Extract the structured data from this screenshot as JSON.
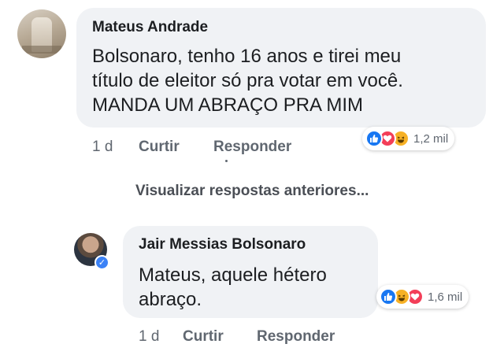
{
  "comment": {
    "author": "Mateus Andrade",
    "lines": [
      "Bolsonaro, tenho 16 anos e tirei meu",
      "título de eleitor só pra votar em você.",
      "MANDA UM ABRAÇO PRA MIM"
    ],
    "time": "1 d",
    "like_label": "Curtir",
    "reply_label": "Responder",
    "reactions": {
      "icons": [
        "like-icon",
        "love-icon",
        "haha-icon"
      ],
      "count": "1,2 mil"
    }
  },
  "view_previous_replies": "Visualizar respostas anteriores...",
  "reply": {
    "author": "Jair Messias Bolsonaro",
    "verified": true,
    "lines": [
      "Mateus, aquele hétero",
      "abraço."
    ],
    "time": "1 d",
    "like_label": "Curtir",
    "reply_label": "Responder",
    "reactions": {
      "icons": [
        "like-icon",
        "haha-icon",
        "love-icon"
      ],
      "count": "1,6 mil"
    }
  },
  "colors": {
    "bubble": "#f0f2f5",
    "like": "#1877f2",
    "love": "#f33e58",
    "haha": "#f7b125",
    "meta_text": "#606770"
  }
}
